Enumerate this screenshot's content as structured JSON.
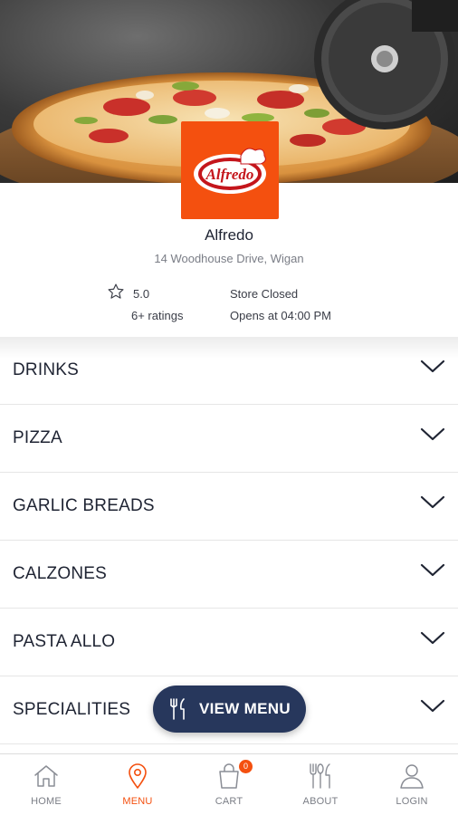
{
  "store": {
    "name": "Alfredo",
    "address": "14 Woodhouse Drive, Wigan",
    "logo_text": "Alfredo",
    "rating": "5.0",
    "rating_count": "6+ ratings",
    "status": "Store Closed",
    "opens_at": "Opens at 04:00 PM"
  },
  "categories": [
    {
      "label": "DRINKS"
    },
    {
      "label": "PIZZA"
    },
    {
      "label": "GARLIC BREADS"
    },
    {
      "label": "CALZONES"
    },
    {
      "label": "PASTA ALLO"
    },
    {
      "label": "SPECIALITIES"
    }
  ],
  "view_menu_button": {
    "label": "VIEW MENU",
    "icon": "utensils-icon"
  },
  "bottom_nav": {
    "items": [
      {
        "label": "HOME",
        "icon": "home-icon",
        "active": false
      },
      {
        "label": "MENU",
        "icon": "location-pin-icon",
        "active": true
      },
      {
        "label": "CART",
        "icon": "cart-bag-icon",
        "active": false,
        "badge": "0"
      },
      {
        "label": "ABOUT",
        "icon": "cutlery-icon",
        "active": false
      },
      {
        "label": "LOGIN",
        "icon": "user-icon",
        "active": false
      }
    ]
  },
  "colors": {
    "accent": "#f4500f",
    "button": "#27375c",
    "text": "#1f2433",
    "muted": "#7a7d86"
  }
}
